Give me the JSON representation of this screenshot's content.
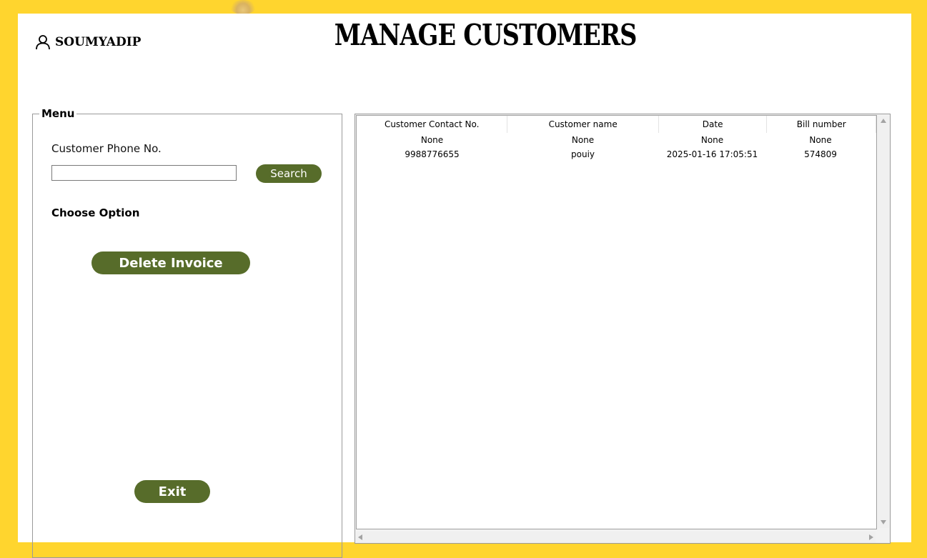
{
  "colors": {
    "background": "#ffd52e",
    "panel": "#ffffff",
    "button": "#576c2a",
    "button_text": "#ffffff"
  },
  "header": {
    "user_icon": "user-icon",
    "username": "SOUMYADIP",
    "title": "MANAGE CUSTOMERS"
  },
  "menu": {
    "legend": "Menu",
    "phone_label": "Customer Phone No.",
    "phone_value": "",
    "search_label": "Search",
    "choose_option": "Choose Option",
    "delete_label": "Delete Invoice",
    "exit_label": "Exit"
  },
  "table": {
    "columns": [
      "Customer Contact No.",
      "Customer name",
      "Date",
      "Bill number"
    ],
    "rows": [
      [
        "None",
        "None",
        "None",
        "None"
      ],
      [
        "9988776655",
        "pouiy",
        "2025-01-16 17:05:51",
        "574809"
      ]
    ]
  }
}
